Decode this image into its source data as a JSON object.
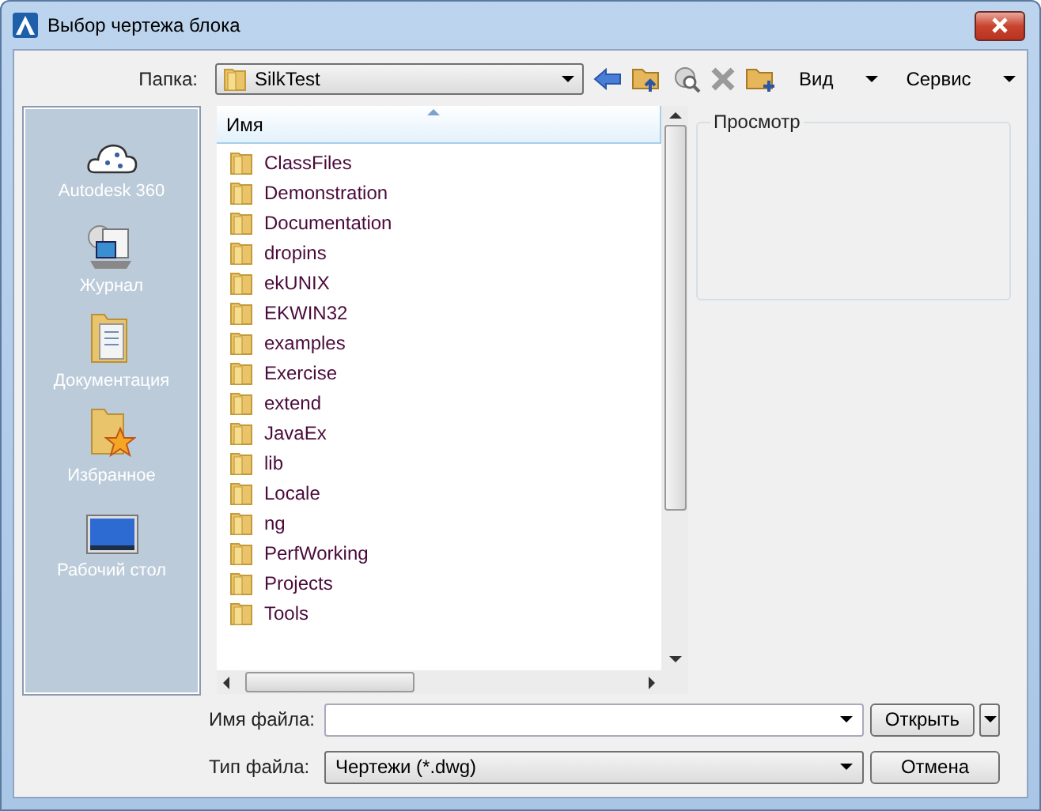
{
  "window": {
    "title": "Выбор чертежа блока"
  },
  "folder": {
    "label": "Папка:",
    "value": "SilkTest"
  },
  "toolbar": {
    "view": "Вид",
    "tools": "Сервис"
  },
  "places": [
    {
      "kind": "cloud",
      "label": "Autodesk 360"
    },
    {
      "kind": "history",
      "label": "Журнал"
    },
    {
      "kind": "documents",
      "label": "Документация"
    },
    {
      "kind": "favorites",
      "label": "Избранное"
    },
    {
      "kind": "desktop",
      "label": "Рабочий стол"
    }
  ],
  "file_list": {
    "columns": [
      "Имя"
    ],
    "rows": [
      "ClassFiles",
      "Demonstration",
      "Documentation",
      "dropins",
      "ekUNIX",
      "EKWIN32",
      "examples",
      "Exercise",
      "extend",
      "JavaEx",
      "lib",
      "Locale",
      "ng",
      "PerfWorking",
      "Projects",
      "Tools"
    ]
  },
  "preview": {
    "title": "Просмотр"
  },
  "file_name": {
    "label": "Имя файла:"
  },
  "file_type": {
    "label": "Тип файла:",
    "value": "Чертежи (*.dwg)"
  },
  "buttons": {
    "open": "Открыть",
    "cancel": "Отмена"
  }
}
